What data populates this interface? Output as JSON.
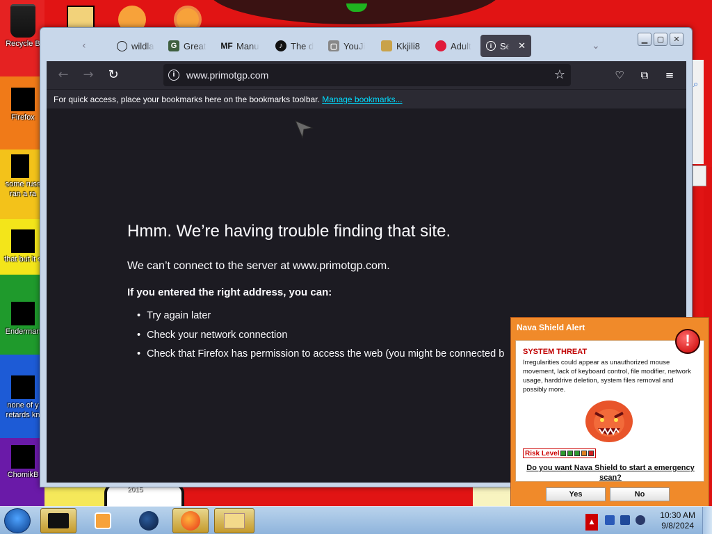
{
  "desktop": {
    "icons": [
      {
        "label": "Recycle B",
        "icon": "recycle-bin-icon"
      },
      {
        "label": "Firefox",
        "icon": "firefox-icon"
      },
      {
        "label": "some russ ran a ra",
        "icon": "file-icon"
      },
      {
        "label": "that but it s",
        "icon": "folder-icon"
      },
      {
        "label": "Enderman",
        "icon": "app-icon"
      },
      {
        "label": "none of y retards kn",
        "icon": "chrome-icon"
      },
      {
        "label": "ChomikB",
        "icon": "app-icon"
      }
    ],
    "year_label": "2015"
  },
  "browser": {
    "tabs": [
      {
        "label": "wildla",
        "icon": "globe-icon"
      },
      {
        "label": "Great",
        "icon": "g-icon"
      },
      {
        "label": "Manu",
        "icon": "mf-icon"
      },
      {
        "label": "The d",
        "icon": "tiktok-icon"
      },
      {
        "label": "YouJi",
        "icon": "youjizz-icon"
      },
      {
        "label": "Kkjili8",
        "icon": "kkjili-icon"
      },
      {
        "label": "Adult",
        "icon": "lips-icon"
      },
      {
        "label": "Ser",
        "icon": "info-icon",
        "active": true
      }
    ],
    "url": "www.primotgp.com",
    "bookmarks_bar": {
      "text": "For quick access, place your bookmarks here on the bookmarks toolbar.",
      "link": "Manage bookmarks..."
    },
    "error": {
      "title": "Hmm. We’re having trouble finding that site.",
      "description": "We can’t connect to the server at www.primotgp.com.",
      "hint": "If you entered the right address, you can:",
      "suggestions": [
        "Try again later",
        "Check your network connection",
        "Check that Firefox has permission to access the web (you might be connected b"
      ]
    }
  },
  "alert": {
    "header": "Nava Shield Alert",
    "threat_title": "SYSTEM THREAT",
    "threat_text": "Irregularities could appear as unauthorized mouse movement, lack of keyboard control, file modifier, network usage, harddrive deletion, system files removal and possibly more.",
    "risk_label": "Risk Level",
    "risk_colors": [
      "#2e9a2e",
      "#2e9a2e",
      "#2e9a2e",
      "#e08020",
      "#d02020"
    ],
    "question": "Do you want Nava Shield to start a emergency scan?",
    "yes_label": "Yes",
    "no_label": "No"
  },
  "taskbar": {
    "time": "10:30 AM",
    "date": "9/8/2024"
  }
}
